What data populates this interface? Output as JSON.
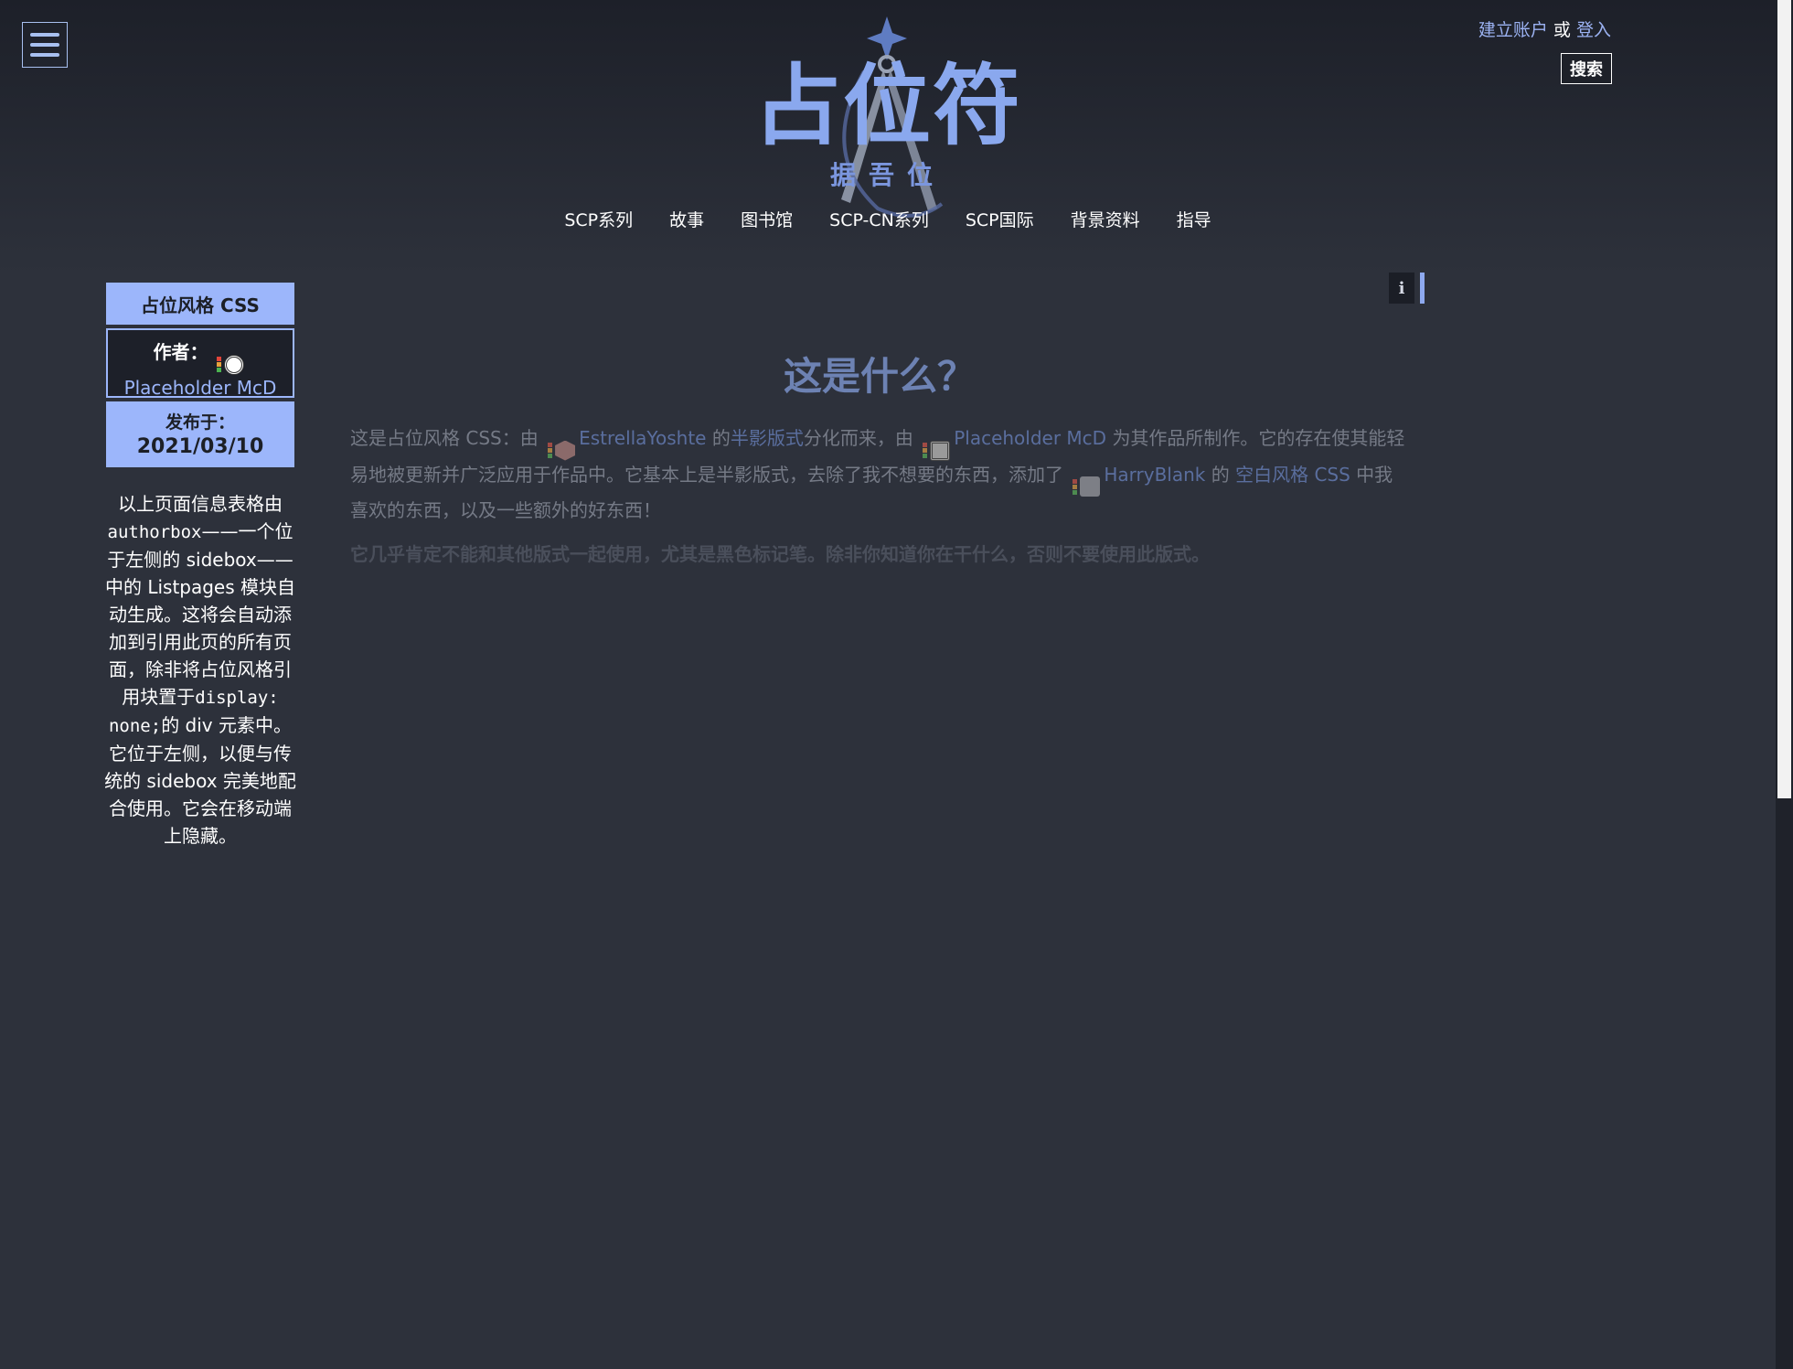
{
  "colors": {
    "background": "#2d313b",
    "accent": "#9cb6fb",
    "heading": "#6d82b3"
  },
  "header": {
    "menu_icon": "hamburger-icon",
    "account": {
      "create": "建立账户",
      "or": "或",
      "login": "登入"
    },
    "search_label": "搜索",
    "logo": {
      "title": "占位符",
      "subtitle": "据吾位"
    },
    "nav": [
      "SCP系列",
      "故事",
      "图书馆",
      "SCP-CN系列",
      "SCP国际",
      "背景资料",
      "指导"
    ],
    "info_icon": "info-icon"
  },
  "authorbox": {
    "title": "占位风格 CSS",
    "author_label": "作者：",
    "author_name": "Placeholder McD",
    "date_label": "发布于：",
    "date_value": "2021/03/10"
  },
  "sidebox": {
    "p1": "以上页面信息表格由",
    "code1": "authorbox",
    "p2": "——一个位于左侧的 sidebox——中的 Listpages 模块自动生成。这将会自动添加到引用此页的所有页面，除非将占位风格引用块置于",
    "code2": "display: none;",
    "p3": "的 div 元素中。它位于左侧，以便与传统的 sidebox 完美地配合使用。它会在移动端上隐藏。"
  },
  "main": {
    "heading": "这是什么？",
    "t1": "这是占位风格 CSS：由",
    "user1": "EstrellaYoshte",
    "t2": "的",
    "link1": "半影版式",
    "t3": "分化而来，由",
    "user2": "Placeholder McD",
    "t4": "为其作品所制作。它的存在使其能轻易地被更新并广泛应用于作品中。它基本上是半影版式，去除了我不想要的东西，添加了",
    "user3": "HarryBlank",
    "t5": "的",
    "link2": "空白风格 CSS",
    "t6": "中我喜欢的东西，以及一些额外的好东西！",
    "warning": "它几乎肯定不能和其他版式一起使用，尤其是黑色标记笔。除非你知道你在干什么，否则不要使用此版式。"
  }
}
